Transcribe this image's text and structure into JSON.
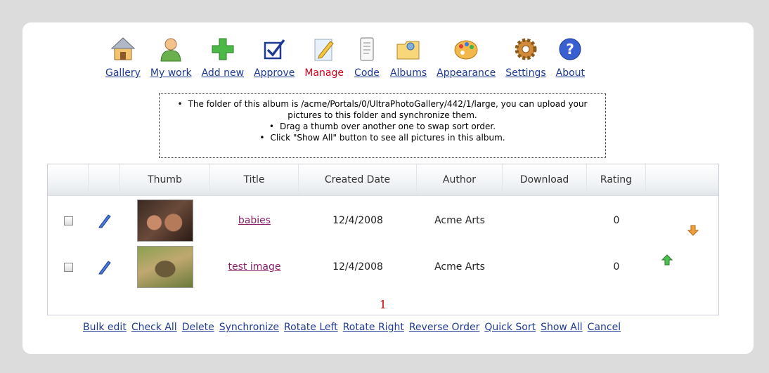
{
  "nav": {
    "items": [
      {
        "label": "Gallery",
        "icon": "house-icon"
      },
      {
        "label": "My work",
        "icon": "person-icon"
      },
      {
        "label": "Add new",
        "icon": "plus-icon"
      },
      {
        "label": "Approve",
        "icon": "checkbox-icon"
      },
      {
        "label": "Manage",
        "icon": "pencil-note-icon",
        "active": true
      },
      {
        "label": "Code",
        "icon": "document-icon"
      },
      {
        "label": "Albums",
        "icon": "folder-icon"
      },
      {
        "label": "Appearance",
        "icon": "palette-icon"
      },
      {
        "label": "Settings",
        "icon": "gear-icon"
      },
      {
        "label": "About",
        "icon": "help-icon"
      }
    ]
  },
  "notice": {
    "lines": [
      "The folder of this album is /acme/Portals/0/UltraPhotoGallery/442/1/large, you can upload your pictures to this folder and synchronize them.",
      "Drag a thumb over another one to swap sort order.",
      "Click \"Show All\" button to see all pictures in this album."
    ]
  },
  "table": {
    "headers": [
      "",
      "",
      "Thumb",
      "Title",
      "Created Date",
      "Author",
      "Download",
      "Rating",
      ""
    ],
    "rows": [
      {
        "title": "babies",
        "created": "12/4/2008",
        "author": "Acme Arts",
        "download": "",
        "rating": "0",
        "move": "down-arrow-icon"
      },
      {
        "title": "test image",
        "created": "12/4/2008",
        "author": "Acme Arts",
        "download": "",
        "rating": "0",
        "move": "up-arrow-icon"
      }
    ],
    "page": "1"
  },
  "actions": [
    "Bulk edit",
    "Check All",
    "Delete",
    "Synchronize",
    "Rotate Left",
    "Rotate Right",
    "Reverse Order",
    "Quick Sort",
    "Show All",
    "Cancel"
  ],
  "colors": {
    "link": "#1f3a93",
    "active": "#d0021b",
    "title_link": "#8a1f6a",
    "page_number": "#cc0000"
  }
}
